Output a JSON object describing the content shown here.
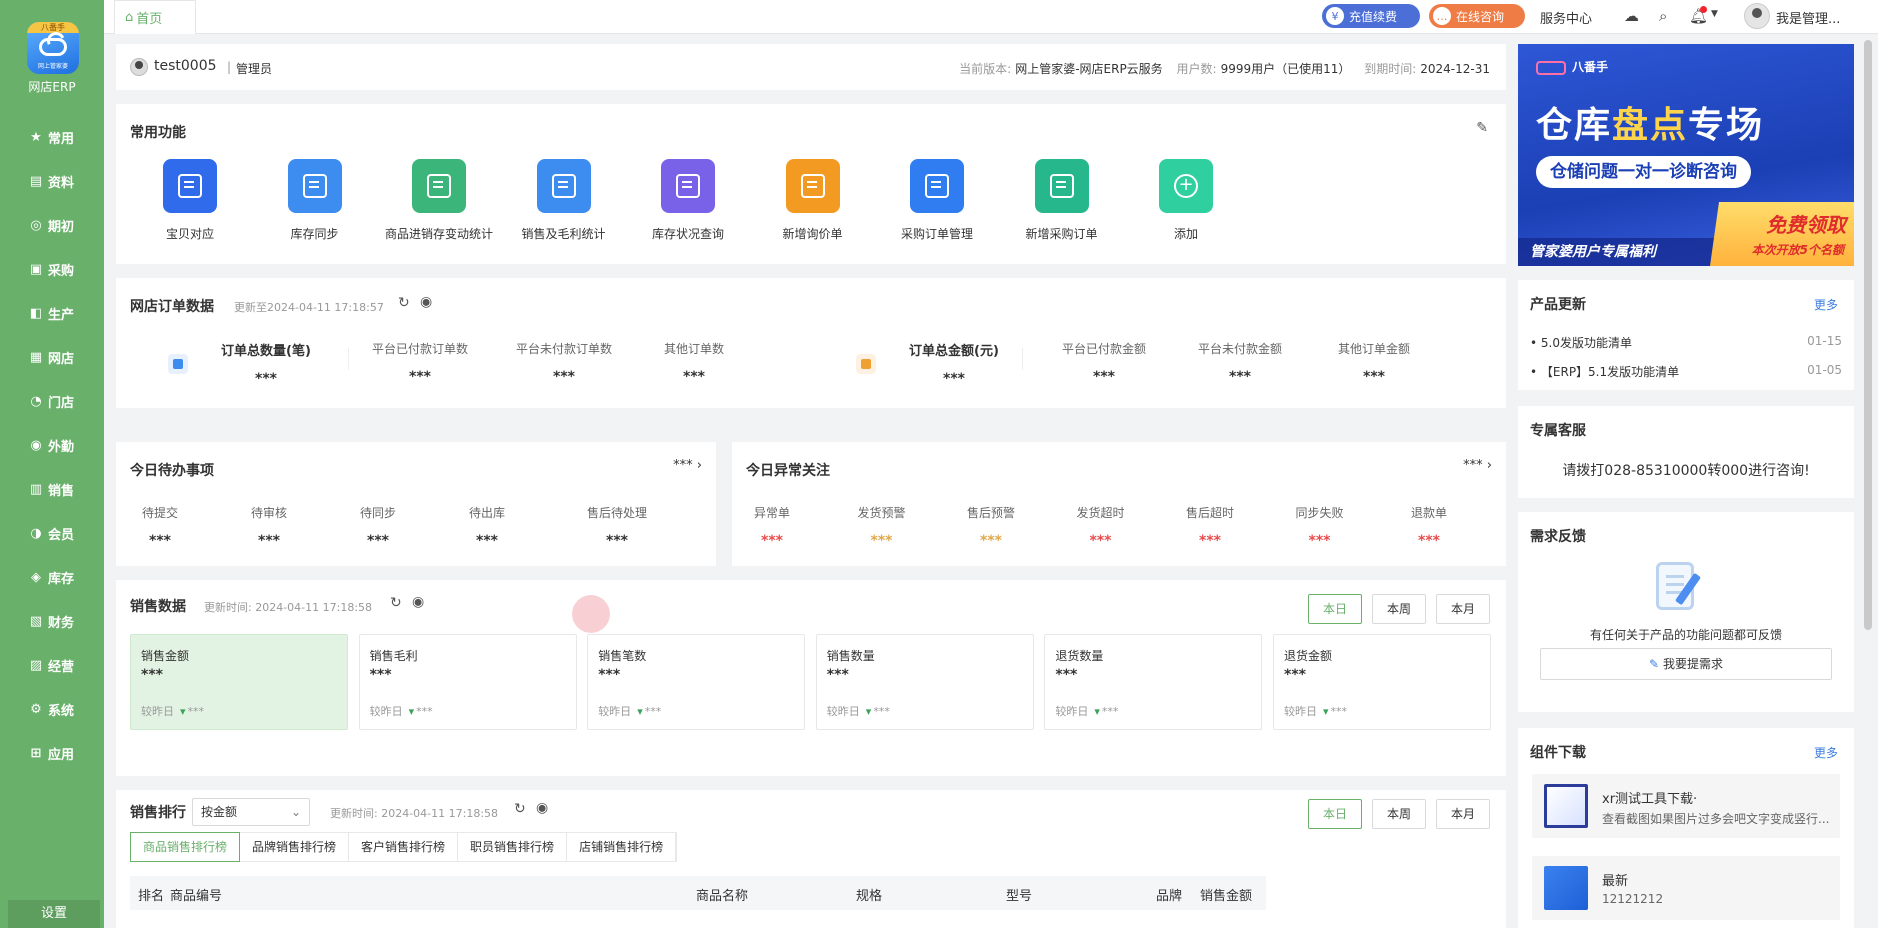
{
  "app": {
    "logo_top": "八番手",
    "logo_sub": "网上管家婆",
    "name": "网店ERP"
  },
  "sidebar": {
    "items": [
      {
        "label": "常用",
        "icon": "star-icon",
        "glyph": "★"
      },
      {
        "label": "资料",
        "icon": "document-icon",
        "glyph": "▤"
      },
      {
        "label": "期初",
        "icon": "target-icon",
        "glyph": "◎"
      },
      {
        "label": "采购",
        "icon": "cart-icon",
        "glyph": "▣"
      },
      {
        "label": "生产",
        "icon": "factory-icon",
        "glyph": "◧"
      },
      {
        "label": "网店",
        "icon": "store-icon",
        "glyph": "▦"
      },
      {
        "label": "门店",
        "icon": "pie-icon",
        "glyph": "◔"
      },
      {
        "label": "外勤",
        "icon": "field-icon",
        "glyph": "◉"
      },
      {
        "label": "销售",
        "icon": "sales-icon",
        "glyph": "▥"
      },
      {
        "label": "会员",
        "icon": "member-icon",
        "glyph": "◑"
      },
      {
        "label": "库存",
        "icon": "inventory-icon",
        "glyph": "◈"
      },
      {
        "label": "财务",
        "icon": "finance-icon",
        "glyph": "▧"
      },
      {
        "label": "经营",
        "icon": "business-icon",
        "glyph": "▨"
      },
      {
        "label": "系统",
        "icon": "system-icon",
        "glyph": "⚙"
      },
      {
        "label": "应用",
        "icon": "apps-icon",
        "glyph": "⊞"
      }
    ],
    "settings": "设置"
  },
  "topbar": {
    "home_tab": "首页",
    "recharge": "充值续费",
    "consult": "在线咨询",
    "service": "服务中心",
    "user": "我是管理..."
  },
  "header": {
    "username": "test0005",
    "role": "管理员",
    "version_label": "当前版本:",
    "version": "网上管家婆-网店ERP云服务",
    "users_label": "用户数:",
    "users": "9999用户（已使用11）",
    "expire_label": "到期时间:",
    "expire": "2024-12-31"
  },
  "common": {
    "title": "常用功能",
    "items": [
      {
        "label": "宝贝对应",
        "color": "#2f6bea"
      },
      {
        "label": "库存同步",
        "color": "#3d8cf0"
      },
      {
        "label": "商品进销存变动统计",
        "color": "#3bb57a"
      },
      {
        "label": "销售及毛利统计",
        "color": "#3d8cf0"
      },
      {
        "label": "库存状况查询",
        "color": "#7a62e8"
      },
      {
        "label": "新增询价单",
        "color": "#f39a22"
      },
      {
        "label": "采购订单管理",
        "color": "#2f7df0"
      },
      {
        "label": "新增采购订单",
        "color": "#26b78c"
      },
      {
        "label": "添加",
        "color": "#2fcfa0"
      }
    ]
  },
  "orders": {
    "title": "网店订单数据",
    "updated": "更新至2024-04-11 17:18:57",
    "qty_title": "订单总数量(笔)",
    "qty_value": "***",
    "qty_items": [
      {
        "label": "平台已付款订单数",
        "value": "***"
      },
      {
        "label": "平台未付款订单数",
        "value": "***"
      },
      {
        "label": "其他订单数",
        "value": "***"
      }
    ],
    "amt_title": "订单总金额(元)",
    "amt_value": "***",
    "amt_items": [
      {
        "label": "平台已付款金额",
        "value": "***"
      },
      {
        "label": "平台未付款金额",
        "value": "***"
      },
      {
        "label": "其他订单金额",
        "value": "***"
      }
    ]
  },
  "todo": {
    "title": "今日待办事项",
    "more": "***",
    "items": [
      {
        "label": "待提交",
        "value": "***"
      },
      {
        "label": "待审核",
        "value": "***"
      },
      {
        "label": "待同步",
        "value": "***"
      },
      {
        "label": "待出库",
        "value": "***"
      },
      {
        "label": "售后待处理",
        "value": "***"
      }
    ]
  },
  "anomaly": {
    "title": "今日异常关注",
    "more": "***",
    "items": [
      {
        "label": "异常单",
        "value": "***",
        "color": "#e84c4c"
      },
      {
        "label": "发货预警",
        "value": "***",
        "color": "#e0a84a"
      },
      {
        "label": "售后预警",
        "value": "***",
        "color": "#e0a84a"
      },
      {
        "label": "发货超时",
        "value": "***",
        "color": "#e84c4c"
      },
      {
        "label": "售后超时",
        "value": "***",
        "color": "#e84c4c"
      },
      {
        "label": "同步失败",
        "value": "***",
        "color": "#e84c4c"
      },
      {
        "label": "退款单",
        "value": "***",
        "color": "#e84c4c"
      }
    ]
  },
  "sales": {
    "title": "销售数据",
    "updated": "更新时间: 2024-04-11 17:18:58",
    "periods": [
      "本日",
      "本周",
      "本月"
    ],
    "cards": [
      {
        "label": "销售金额",
        "value": "***",
        "compare": "较昨日",
        "delta": "***"
      },
      {
        "label": "销售毛利",
        "value": "***",
        "compare": "较昨日",
        "delta": "***"
      },
      {
        "label": "销售笔数",
        "value": "***",
        "compare": "较昨日",
        "delta": "***"
      },
      {
        "label": "销售数量",
        "value": "***",
        "compare": "较昨日",
        "delta": "***"
      },
      {
        "label": "退货数量",
        "value": "***",
        "compare": "较昨日",
        "delta": "***"
      },
      {
        "label": "退货金额",
        "value": "***",
        "compare": "较昨日",
        "delta": "***"
      }
    ]
  },
  "ranking": {
    "title": "销售排行",
    "select": "按金额",
    "updated": "更新时间: 2024-04-11 17:18:58",
    "periods": [
      "本日",
      "本周",
      "本月"
    ],
    "tabs": [
      "商品销售排行榜",
      "品牌销售排行榜",
      "客户销售排行榜",
      "职员销售排行榜",
      "店铺销售排行榜"
    ],
    "columns": [
      "排名",
      "商品编号",
      "商品名称",
      "规格",
      "型号",
      "品牌",
      "销售金额"
    ]
  },
  "banner": {
    "brand": "八番手",
    "headline_a": "仓库",
    "headline_b": "盘点",
    "headline_c": "专场",
    "pill": "仓储问题一对一诊断咨询",
    "footer": "管家婆用户专属福利",
    "badge_big": "免费领取",
    "badge_small": "本次开放5个名额"
  },
  "updates": {
    "title": "产品更新",
    "more": "更多",
    "items": [
      {
        "text": "• 5.0发版功能清单",
        "date": "01-15"
      },
      {
        "text": "• 【ERP】5.1发版功能清单",
        "date": "01-05"
      }
    ]
  },
  "service": {
    "title": "专属客服",
    "text": "请拨打028-85310000转000进行咨询!"
  },
  "feedback": {
    "title": "需求反馈",
    "text": "有任何关于产品的功能问题都可反馈",
    "button": "我要提需求"
  },
  "downloads": {
    "title": "组件下载",
    "more": "更多",
    "items": [
      {
        "name": "xr测试工具下载·",
        "desc": "查看截图如果图片过多会吧文字变成竖行..."
      },
      {
        "name": "最新",
        "desc": "12121212"
      }
    ]
  }
}
